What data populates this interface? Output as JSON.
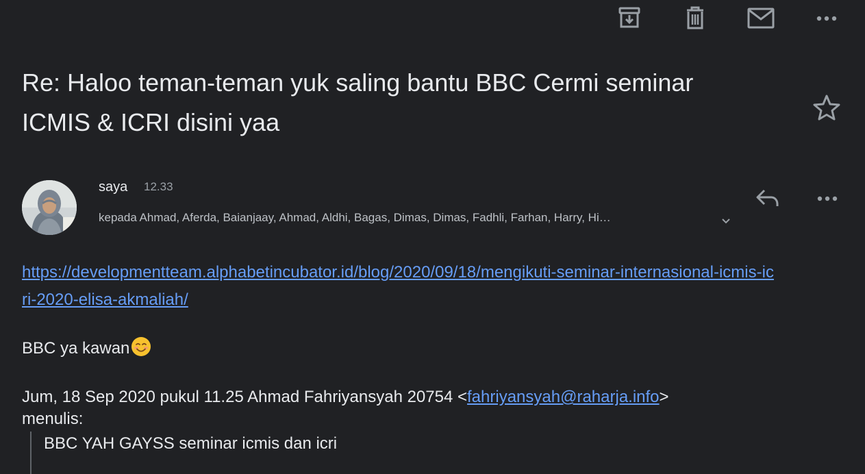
{
  "toolbar": {
    "archive_icon": "archive-icon",
    "delete_icon": "trash-icon",
    "mark_unread_icon": "mail-icon",
    "more_icon": "more-horizontal-icon"
  },
  "email": {
    "subject": "Re: Haloo teman-teman yuk saling bantu BBC Cermi seminar ICMIS & ICRI disini yaa",
    "sender": "saya",
    "time": "12.33",
    "recipients": "kepada Ahmad, Aferda, Baianjaay, Ahmad, Aldhi, Bagas, Dimas, Dimas, Fadhli, Farhan, Harry, Hi…",
    "link": "https://developmentteam.alphabetincubator.id/blog/2020/09/18/mengikuti-seminar-internasional-icmis-icri-2020-elisa-akmaliah/",
    "body_text": "BBC ya kawan",
    "quote_header_prefix": "Jum, 18 Sep 2020 pukul 11.25 Ahmad Fahriyansyah 20754 <",
    "quote_email": "fahriyansyah@raharja.info",
    "quote_header_suffix": ">",
    "quote_header_line2": "menulis:",
    "quoted_text": "BBC YAH GAYSS seminar icmis dan icri"
  },
  "colors": {
    "background": "#202124",
    "text": "#e8eaed",
    "secondary_text": "#9aa0a6",
    "link": "#669df6",
    "icon": "#9aa0a6"
  }
}
